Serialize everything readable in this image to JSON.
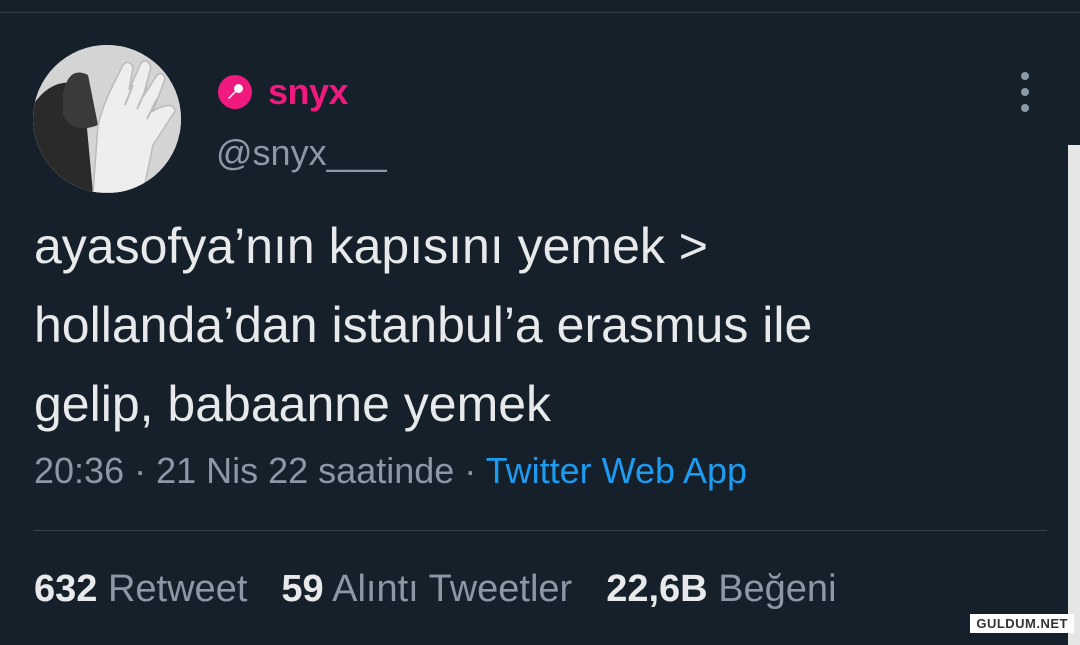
{
  "tweet": {
    "author": {
      "display_name": "snyx",
      "handle": "@snyx___"
    },
    "text_lines": [
      "ayasofya’nın kapısını yemek >",
      "hollanda’dan istanbul’a erasmus ile",
      "gelip, babaanne yemek"
    ],
    "timestamp": "20:36 · 21 Nis 22 saatinde",
    "separator": " · ",
    "source": "Twitter Web App",
    "stats": {
      "retweets": {
        "count": "632",
        "label": "Retweet"
      },
      "quotes": {
        "count": "59",
        "label": "Alıntı Tweetler"
      },
      "likes": {
        "count": "22,6B",
        "label": "Beğeni"
      }
    }
  },
  "watermark": "GULDUM.NET",
  "colors": {
    "background": "#15202b",
    "name_accent": "#f0197d",
    "link": "#1d9bf0",
    "secondary_text": "#8b98a5",
    "primary_text": "#e7e9ea"
  },
  "icons": {
    "badge": "microphone-icon",
    "menu": "more-options-icon"
  }
}
